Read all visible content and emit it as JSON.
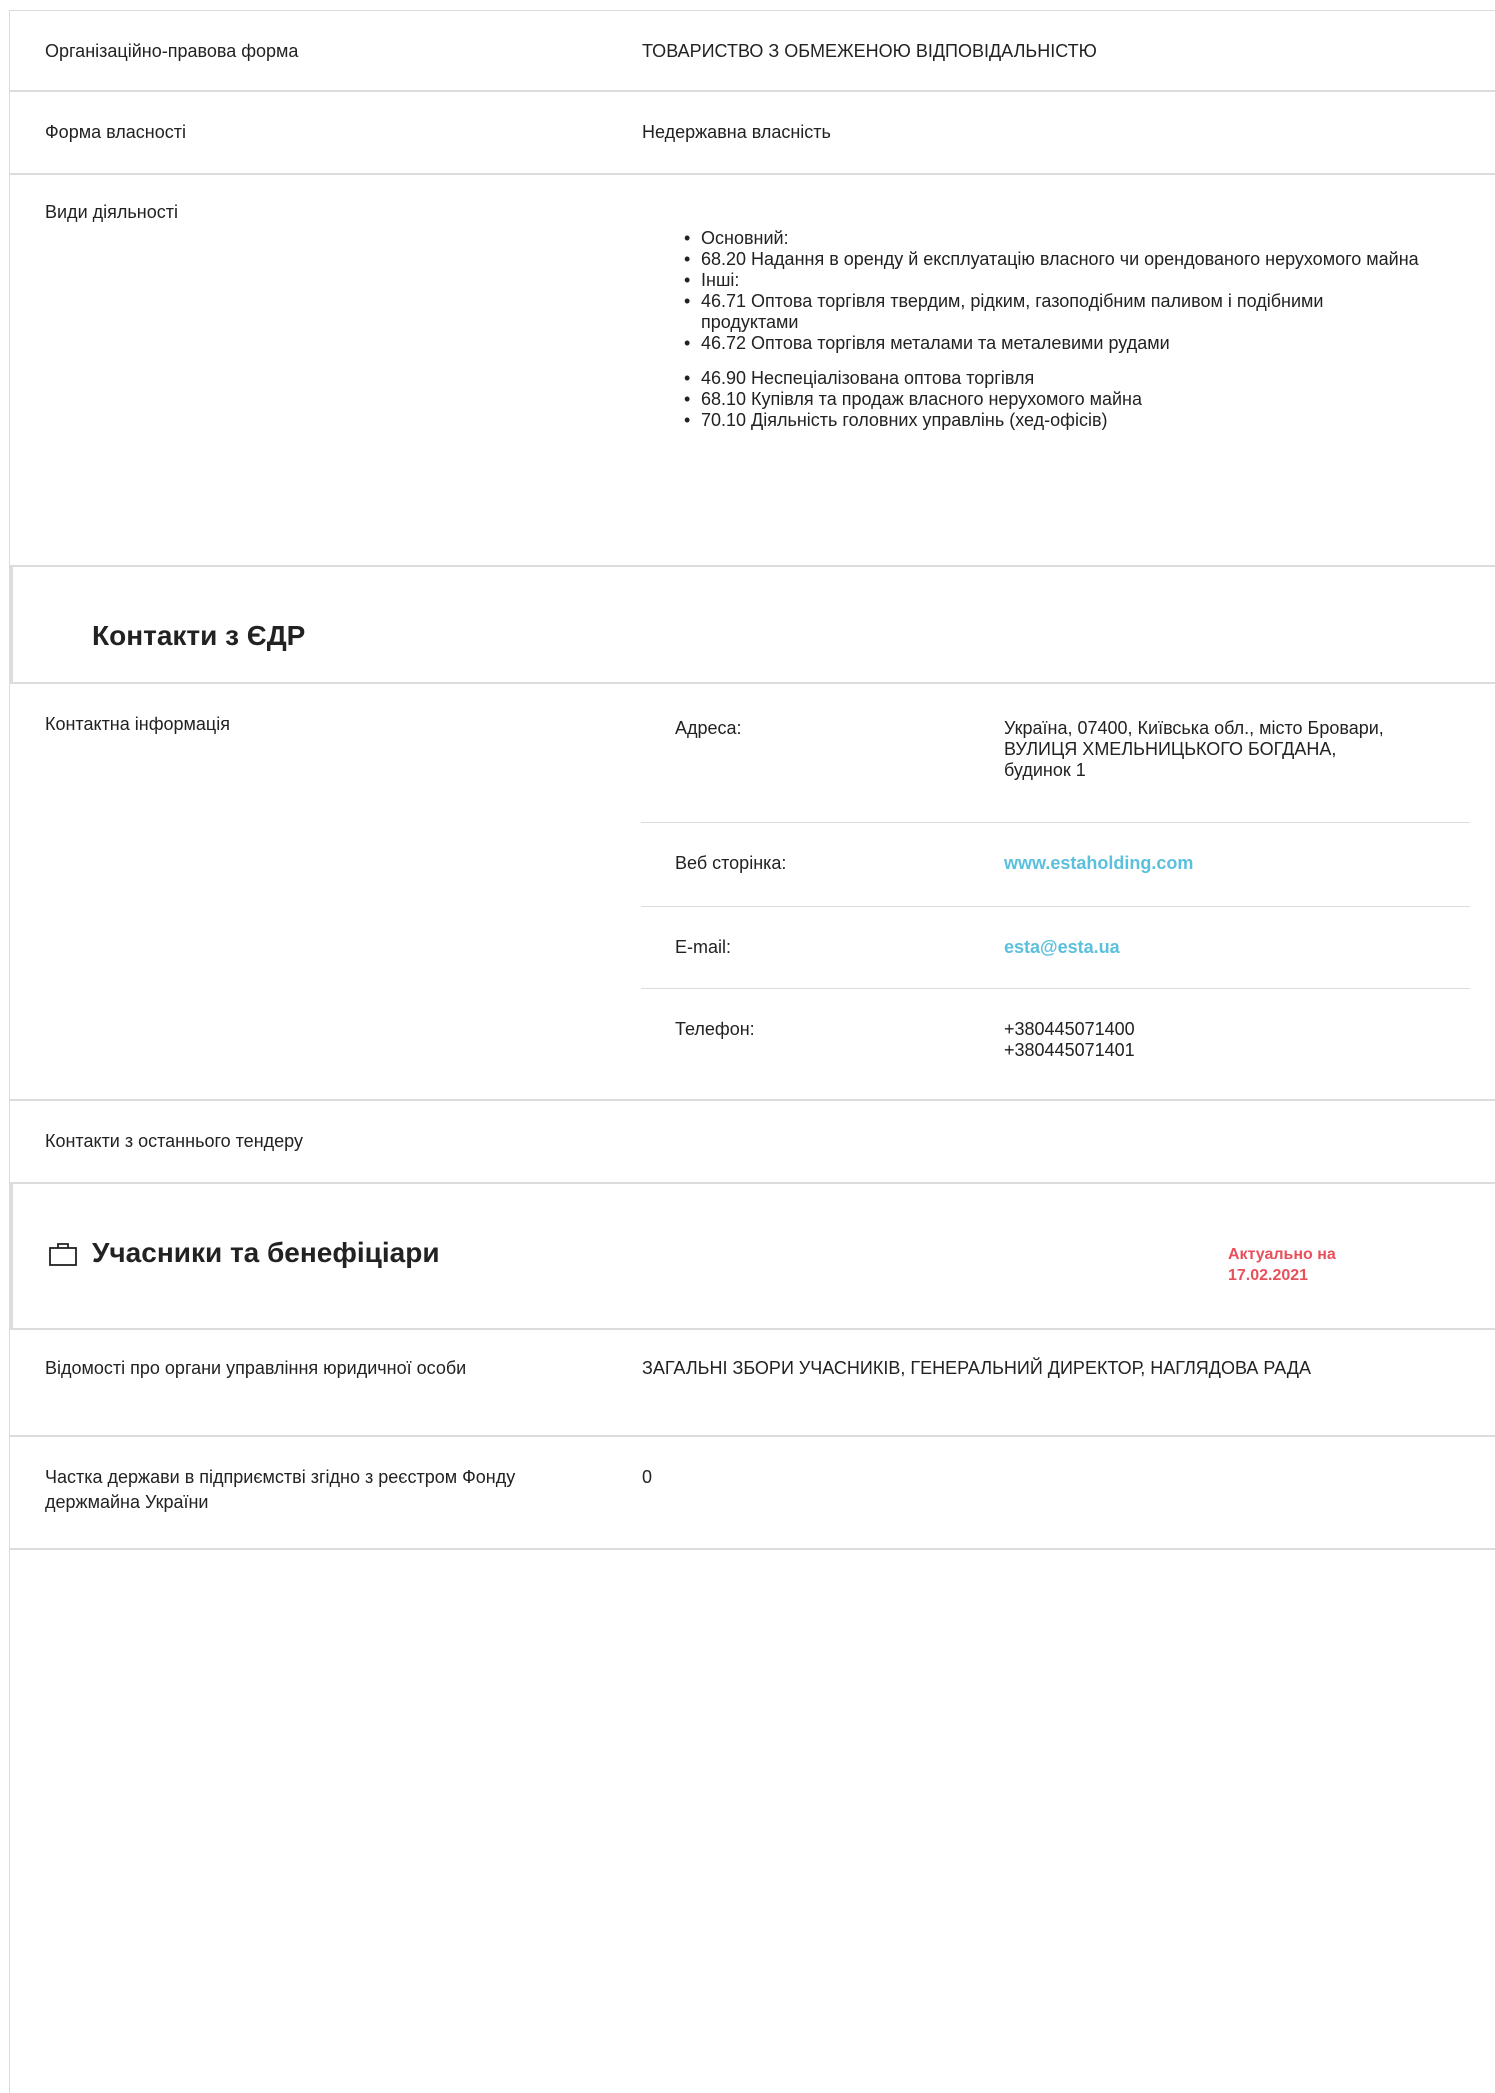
{
  "general": {
    "legal_form_label": "Організаційно-правова форма",
    "legal_form_value": "ТОВАРИСТВО З ОБМЕЖЕНОЮ ВІДПОВІДАЛЬНІСТЮ",
    "ownership_label": "Форма власності",
    "ownership_value": "Недержавна власність",
    "activities_label": "Види діяльності",
    "activities": [
      "Основний:",
      "68.20 Надання в оренду й експлуатацію власного чи орендованого нерухомого майна",
      "Інші:",
      "46.71 Оптова торгівля твердим, рідким, газоподібним паливом і подібними продуктами",
      "46.72 Оптова торгівля металами та металевими рудами",
      "46.90 Неспеціалізована оптова торгівля",
      "68.10 Купівля та продаж власного нерухомого майна",
      "70.10 Діяльність головних управлінь (хед-офісів)"
    ]
  },
  "contacts": {
    "title": "Контакти з ЄДР",
    "info_label": "Контактна інформація",
    "address_label": "Адреса:",
    "address_value": "Україна, 07400, Київська обл., місто Бровари, ВУЛИЦЯ ХМЕЛЬНИЦЬКОГО БОГДАНА, будинок 1",
    "website_label": "Веб сторінка:",
    "website_value": "www.estaholding.com",
    "email_label": "E-mail:",
    "email_value": "esta@esta.ua",
    "phone_label": "Телефон:",
    "phones": [
      "+380445071400",
      "+380445071401"
    ],
    "last_tender_label": "Контакти з останнього тендеру"
  },
  "participants": {
    "title": "Учасники та бенефіціари",
    "icon": "briefcase-icon",
    "actual_prefix": "Актуально на",
    "actual_date": "17.02.2021",
    "management_label": "Відомості про органи управління юридичної особи",
    "management_value": "ЗАГАЛЬНІ ЗБОРИ УЧАСНИКІВ, ГЕНЕРАЛЬНИЙ ДИРЕКТОР, НАГЛЯДОВА РАДА",
    "state_share_label": "Частка держави в підприємстві згідно з реєстром Фонду держмайна України",
    "state_share_value": "0"
  },
  "colors": {
    "link": "#5bc0de",
    "actual_date": "#e8505b",
    "border": "#dcdcdc"
  }
}
